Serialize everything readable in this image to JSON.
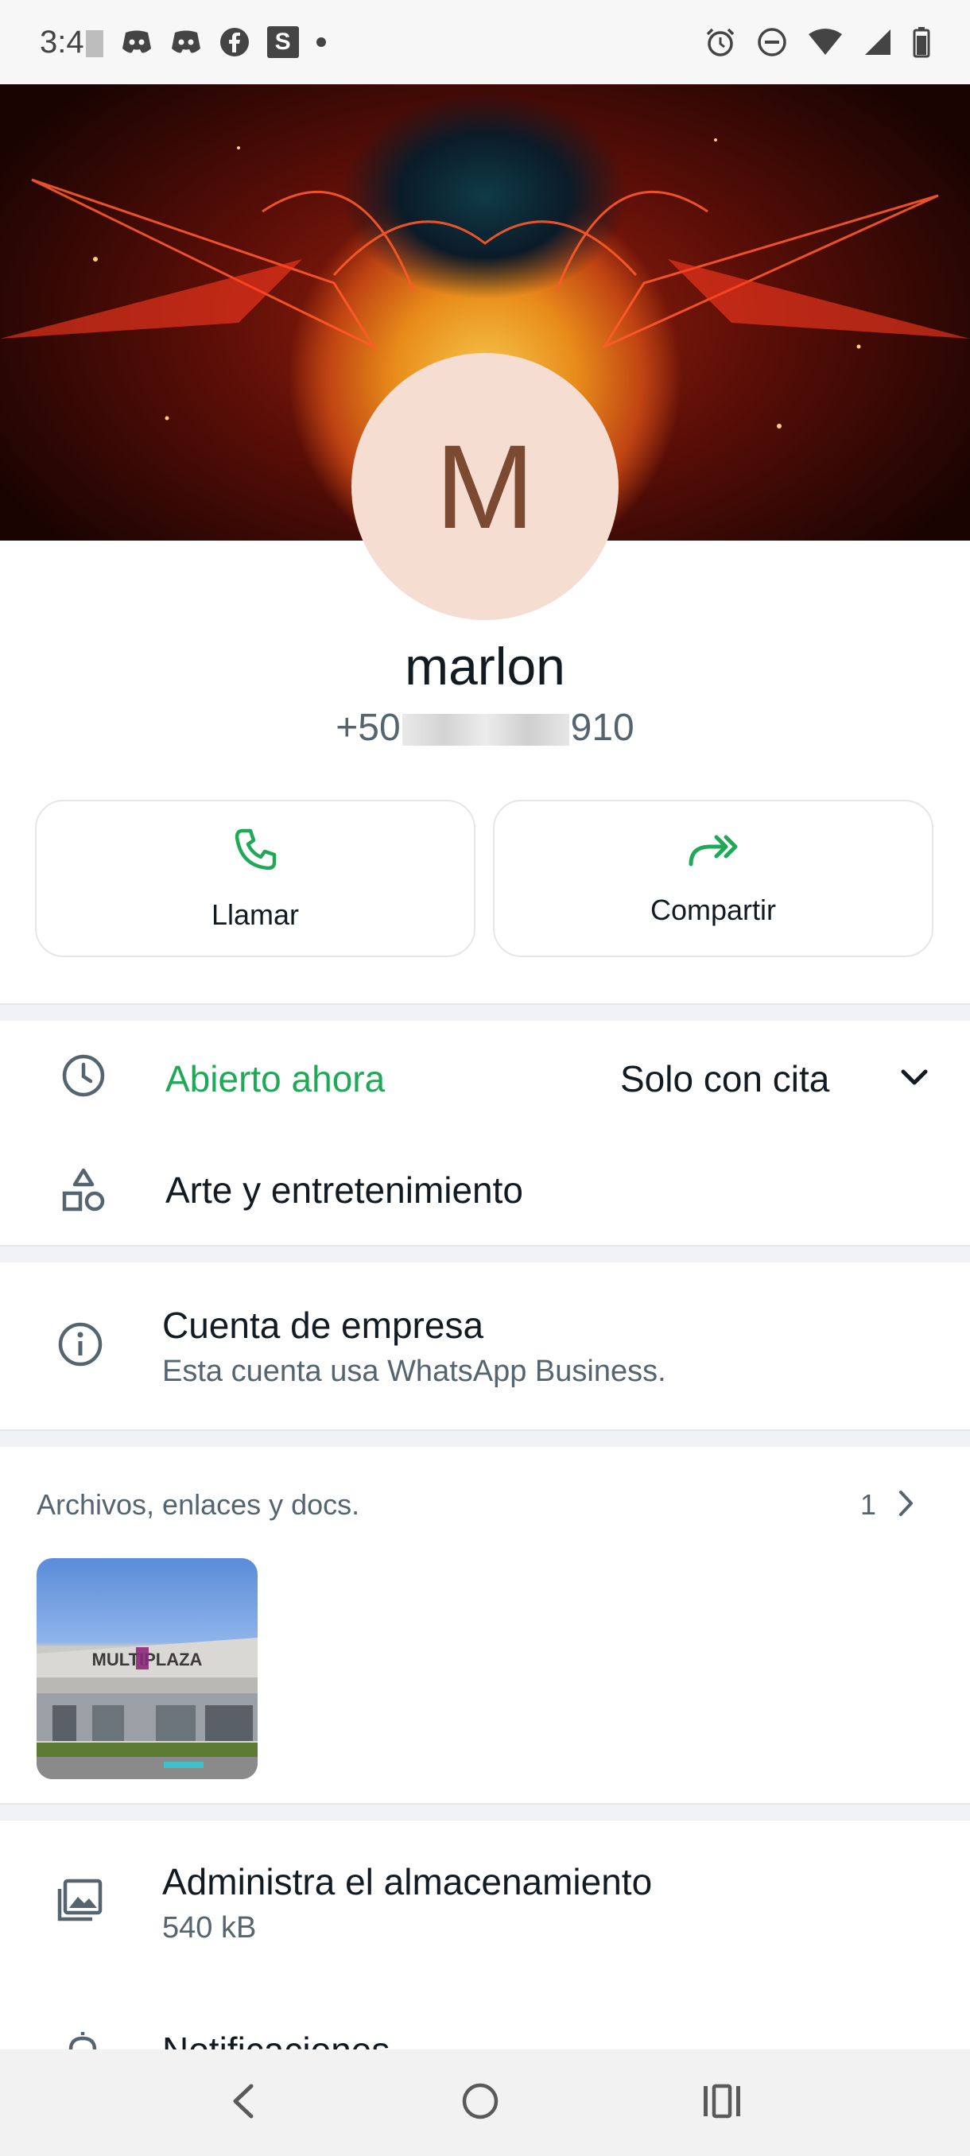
{
  "status_bar": {
    "time": "3:4"
  },
  "profile": {
    "initial": "M",
    "name": "marlon",
    "phone_prefix": "+50",
    "phone_suffix": "910"
  },
  "actions": {
    "call_label": "Llamar",
    "share_label": "Compartir"
  },
  "business_info": {
    "open_status": "Abierto ahora",
    "hours_note": "Solo con cita",
    "category": "Arte y entretenimiento",
    "open_status_color": "#1fa855"
  },
  "business_account": {
    "title": "Cuenta de empresa",
    "subtitle": "Esta cuenta usa WhatsApp Business."
  },
  "media": {
    "heading": "Archivos, enlaces y docs.",
    "count": "1",
    "thumbnail_text": "MULTIPLAZA"
  },
  "storage": {
    "title": "Administra el almacenamiento",
    "size": "540 kB"
  },
  "notifications": {
    "title": "Notificaciones"
  },
  "theme": {
    "accent_green": "#1fa855",
    "primary_text": "#111b21",
    "secondary_text": "#54656f"
  }
}
